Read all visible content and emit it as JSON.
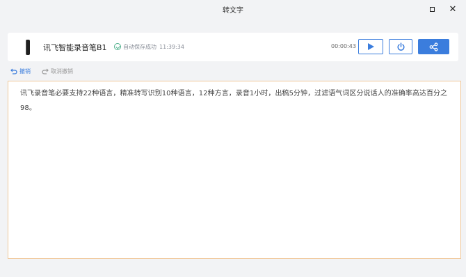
{
  "window": {
    "title": "转文字"
  },
  "device": {
    "name": "讯飞智能录音笔B1",
    "save_status": "自动保存成功",
    "save_time": "11:39:34",
    "duration": "00:00:43"
  },
  "toolbar": {
    "undo_label": "撤销",
    "redo_label": "取消撤销"
  },
  "editor": {
    "text": "讯飞录音笔必要支持22种语言，精准转写识别10种语言，12种方言，录音1小时，出稿5分钟，过滤语气词区分说话人的准确率高达百分之98。"
  },
  "colors": {
    "accent": "#3b7ddd",
    "editor_border": "#f0c89a",
    "success": "#4caf8a"
  },
  "icons": [
    "play-icon",
    "power-icon",
    "share-icon",
    "undo-icon",
    "redo-icon",
    "check-circle-icon"
  ]
}
